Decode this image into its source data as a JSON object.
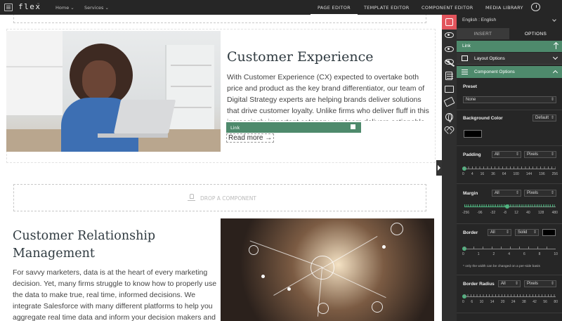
{
  "topbar": {
    "logo": "flex",
    "logo_tm": "™",
    "nav": [
      "Home",
      "Services"
    ],
    "tabs": [
      "PAGE EDITOR",
      "TEMPLATE EDITOR",
      "COMPONENT EDITOR",
      "MEDIA LIBRARY"
    ],
    "active_tab": "PAGE EDITOR"
  },
  "canvas": {
    "section1": {
      "title": "Customer Experience",
      "body": "With Customer Experience (CX) expected to overtake both price and product as the key brand differentiator, our team of Digital Strategy experts are helping brands deliver solutions that drive customer loyalty. Unlike firms who deliver fluff in this increasingly important category, our team delivers actionable results to help you engage",
      "link_bar_label": "Link",
      "read_more": "Read more →"
    },
    "dropzone": "DROP A COMPONENT",
    "section2": {
      "title": "Customer Relationship Management",
      "body": "For savvy marketers, data is at the heart of every marketing decision. Yet, many firms struggle to know how to properly use the data to make true, real time, informed decisions. We integrate Salesforce with many different platforms to help you aggregate real time data and inform your decision makers and stakeholders."
    }
  },
  "panel": {
    "language": "English : English",
    "tabs": {
      "insert": "INSERT",
      "options": "OPTIONS"
    },
    "link_row": "Link",
    "layout_options": "Layout Options",
    "component_options": "Component Options",
    "preset": {
      "label": "Preset",
      "value": "None"
    },
    "background_color": {
      "label": "Background Color",
      "value": "Default",
      "swatch": "#000000"
    },
    "padding": {
      "label": "Padding",
      "side": "All",
      "unit": "Pixels",
      "ticks": [
        "0",
        "1",
        "4",
        "9",
        "16",
        "25",
        "36",
        "49",
        "64",
        "81",
        "100",
        "121",
        "144",
        "169",
        "196",
        "225",
        "256"
      ],
      "tick_labels": [
        "0",
        "4",
        "16",
        "36",
        "64",
        "100",
        "144",
        "196",
        "256"
      ],
      "value": 0
    },
    "margin": {
      "label": "Margin",
      "side": "All",
      "unit": "Pixels",
      "tick_labels": [
        "-256",
        "-96",
        "-32",
        "-8",
        "12",
        "40",
        "128",
        "480"
      ],
      "value": 0
    },
    "border": {
      "label": "Border",
      "side": "All",
      "style": "Solid",
      "swatch": "#000000",
      "tick_labels": [
        "0",
        "1",
        "2",
        "4",
        "6",
        "8",
        "10"
      ],
      "value": 0,
      "note": "* only the width can be changed on a per-side basis"
    },
    "border_radius": {
      "label": "Border Radius",
      "side": "All",
      "unit": "Pixels",
      "tick_labels": [
        "0",
        "6",
        "10",
        "14",
        "20",
        "24",
        "38",
        "42",
        "56",
        "80"
      ],
      "value": 0
    }
  },
  "colors": {
    "accent_green": "#4e8a6c",
    "slider_green": "#4fb37f",
    "rail_active": "#e2545c",
    "topbar": "#262626"
  }
}
